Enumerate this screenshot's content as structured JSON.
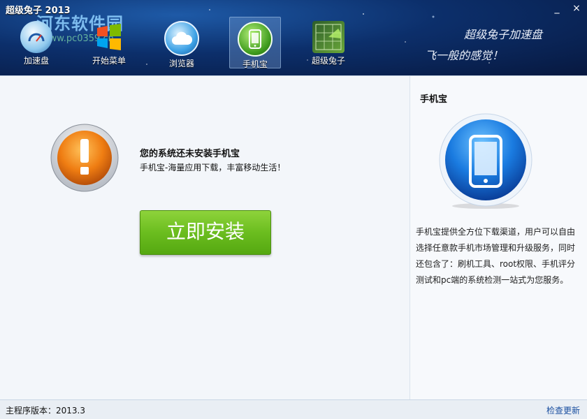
{
  "window": {
    "title": "超级兔子 2013",
    "minimize": "_",
    "close": "×"
  },
  "watermark": {
    "text": "河东软件园",
    "url": "www.pc0359.cn"
  },
  "nav": [
    {
      "label": "加速盘",
      "icon": "gauge-icon"
    },
    {
      "label": "开始菜单",
      "icon": "windows-logo-icon"
    },
    {
      "label": "浏览器",
      "icon": "cloud-icon"
    },
    {
      "label": "手机宝",
      "icon": "phone-icon",
      "active": true
    },
    {
      "label": "超级兔子",
      "icon": "radar-icon"
    }
  ],
  "slogan": {
    "line1": "超级兔子加速盘",
    "line2": "飞一般的感觉！"
  },
  "main": {
    "warning_icon": "exclamation-icon",
    "title": "您的系统还未安装手机宝",
    "subtitle": "手机宝-海量应用下载，丰富移动生活！",
    "install_button": "立即安装"
  },
  "side": {
    "title": "手机宝",
    "icon": "phone-icon",
    "description": "手机宝提供全方位下载渠道，用户可以自由选择任意款手机市场管理和升级服务，同时还包含了：刷机工具、root权限、手机评分测试和pc端的系统检测一站式为您服务。"
  },
  "status": {
    "version": "主程序版本：2013.3",
    "update_link": "检查更新"
  },
  "colors": {
    "header": "#0c2f6b",
    "accent": "#1a4fa0",
    "install": "#6bbd1f",
    "warning": "#e86f0c"
  }
}
